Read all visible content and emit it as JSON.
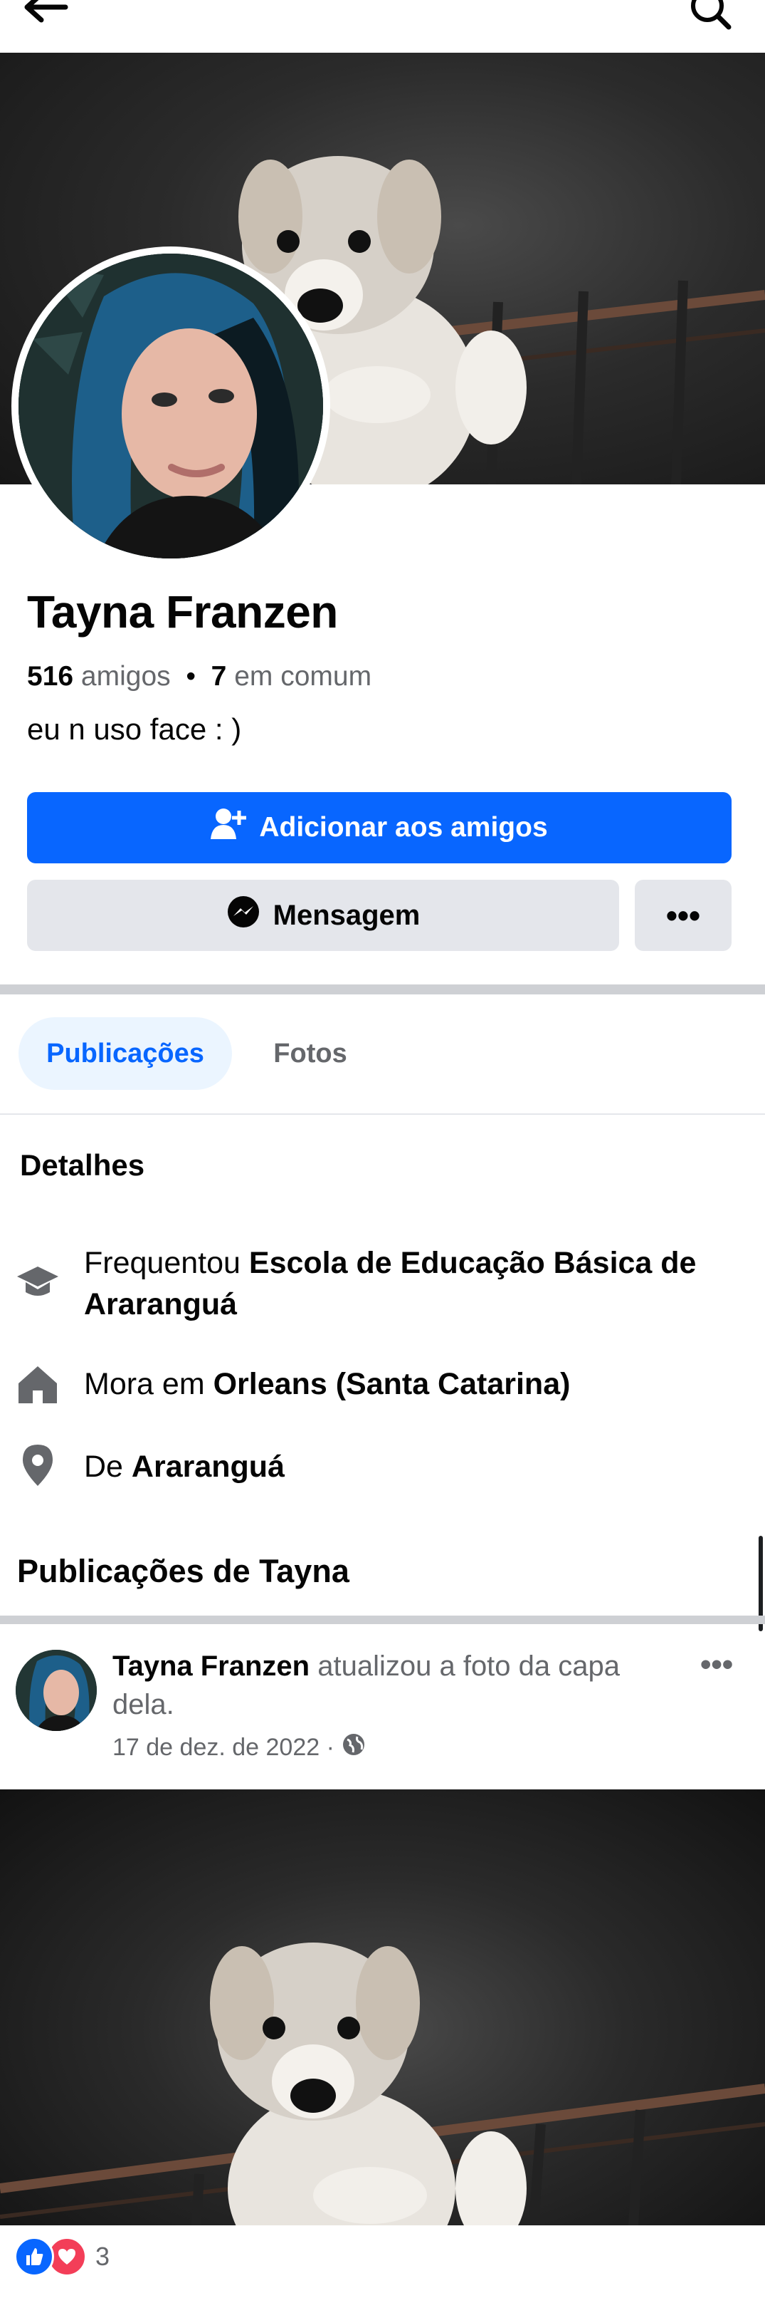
{
  "colors": {
    "accent": "#0866ff",
    "button_bg": "#e4e6eb",
    "secondary_text": "#65676b",
    "tab_active_bg": "#ebf5ff"
  },
  "icons": {
    "back": "arrow-left-icon",
    "search": "search-icon",
    "add_friend": "person-plus-icon",
    "messenger": "messenger-icon",
    "more": "ellipsis-icon",
    "education": "graduation-cap-icon",
    "home": "house-icon",
    "location": "location-pin-icon",
    "globe": "globe-icon",
    "like": "like-reaction-icon",
    "love": "love-reaction-icon"
  },
  "profile": {
    "name": "Tayna Franzen",
    "friends_count": "516",
    "friends_label": "amigos",
    "dot": "•",
    "mutual_count": "7",
    "mutual_label": "em comum",
    "bio": "eu n uso face : )"
  },
  "actions": {
    "add_friend_label": "Adicionar aos amigos",
    "message_label": "Mensagem",
    "more_label": "•••"
  },
  "tabs": [
    {
      "label": "Publicações",
      "active": true
    },
    {
      "label": "Fotos",
      "active": false
    }
  ],
  "details": {
    "heading": "Detalhes",
    "education_prefix": "Frequentou",
    "education_place": "Escola de Educação Básica de Araranguá",
    "home_prefix": "Mora em",
    "home_place": "Orleans (Santa Catarina)",
    "from_prefix": "De",
    "from_place": "Araranguá"
  },
  "posts": {
    "heading": "Publicações de Tayna",
    "items": [
      {
        "author": "Tayna Franzen",
        "action": "atualizou a foto da capa dela.",
        "date": "17 de dez. de 2022 ·",
        "more_label": "•••",
        "reaction_count": "3"
      }
    ]
  }
}
